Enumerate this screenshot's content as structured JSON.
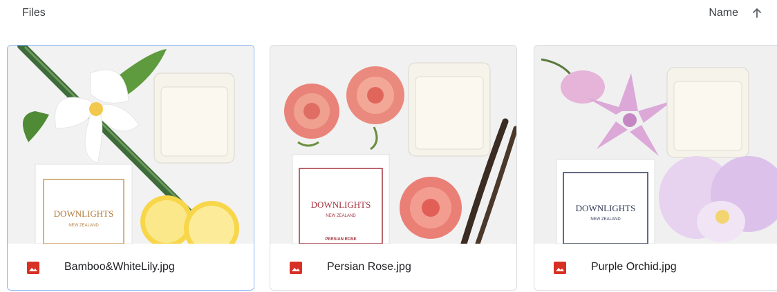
{
  "header": {
    "title": "Files",
    "sort_label": "Name",
    "sort_icon": "arrow-up-icon"
  },
  "files": [
    {
      "name": "Bamboo&WhiteLily.jpg",
      "icon": "image-file-icon",
      "thumbnail_brand": "DOWNLIGHTS",
      "thumbnail_sub": "NEW ZEALAND",
      "selected": true
    },
    {
      "name": "Persian Rose.jpg",
      "icon": "image-file-icon",
      "thumbnail_brand": "DOWNLIGHTS",
      "thumbnail_sub": "NEW ZEALAND",
      "thumbnail_product": "PERSIAN ROSE",
      "selected": false
    },
    {
      "name": "Purple Orchid.jpg",
      "icon": "image-file-icon",
      "thumbnail_brand": "DOWNLIGHTS",
      "thumbnail_sub": "NEW ZEALAND",
      "selected": false
    }
  ],
  "colors": {
    "file_icon": "#d93025",
    "selected_border": "#8ab4f8"
  }
}
